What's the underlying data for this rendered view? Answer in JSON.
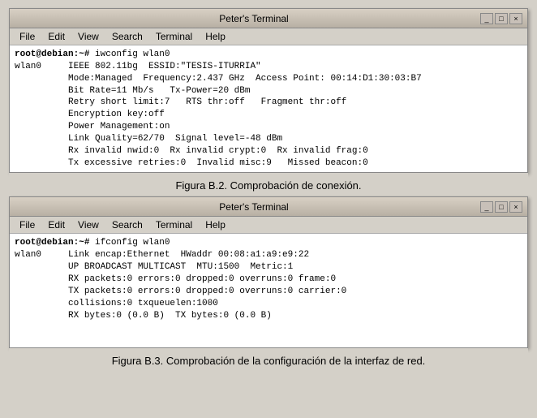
{
  "terminal1": {
    "title": "Peter's Terminal",
    "menuItems": [
      "File",
      "Edit",
      "View",
      "Search",
      "Terminal",
      "Help"
    ],
    "controls": {
      "minimize": "_",
      "maximize": "□",
      "close": "×"
    },
    "content": [
      {
        "type": "prompt",
        "text": "root@debian:~# iwconfig wlan0"
      },
      {
        "type": "output",
        "text": "wlan0     IEEE 802.11bg  ESSID:\"TESIS-ITURRIA\""
      },
      {
        "type": "output",
        "text": "          Mode:Managed  Frequency:2.437 GHz  Access Point: 00:14:D1:30:03:B7"
      },
      {
        "type": "output",
        "text": "          Bit Rate=11 Mb/s   Tx-Power=20 dBm"
      },
      {
        "type": "output",
        "text": "          Retry short limit:7   RTS thr:off   Fragment thr:off"
      },
      {
        "type": "output",
        "text": "          Encryption key:off"
      },
      {
        "type": "output",
        "text": "          Power Management:on"
      },
      {
        "type": "output",
        "text": "          Link Quality=62/70  Signal level=-48 dBm"
      },
      {
        "type": "output",
        "text": "          Rx invalid nwid:0  Rx invalid crypt:0  Rx invalid frag:0"
      },
      {
        "type": "output",
        "text": "          Tx excessive retries:0  Invalid misc:9   Missed beacon:0"
      }
    ],
    "caption": "Figura B.2. Comprobación de conexión."
  },
  "terminal2": {
    "title": "Peter's Terminal",
    "menuItems": [
      "File",
      "Edit",
      "View",
      "Search",
      "Terminal",
      "Help"
    ],
    "controls": {
      "minimize": "_",
      "maximize": "□",
      "close": "×"
    },
    "content": [
      {
        "type": "prompt",
        "text": "root@debian:~# ifconfig wlan0"
      },
      {
        "type": "output",
        "text": "wlan0     Link encap:Ethernet  HWaddr 00:08:a1:a9:e9:22"
      },
      {
        "type": "output",
        "text": "          UP BROADCAST MULTICAST  MTU:1500  Metric:1"
      },
      {
        "type": "output",
        "text": "          RX packets:0 errors:0 dropped:0 overruns:0 frame:0"
      },
      {
        "type": "output",
        "text": "          TX packets:0 errors:0 dropped:0 overruns:0 carrier:0"
      },
      {
        "type": "output",
        "text": "          collisions:0 txqueuelen:1000"
      },
      {
        "type": "output",
        "text": "          RX bytes:0 (0.0 B)  TX bytes:0 (0.0 B)"
      }
    ],
    "caption": "Figura B.3. Comprobación de la configuración de la interfaz de red."
  }
}
